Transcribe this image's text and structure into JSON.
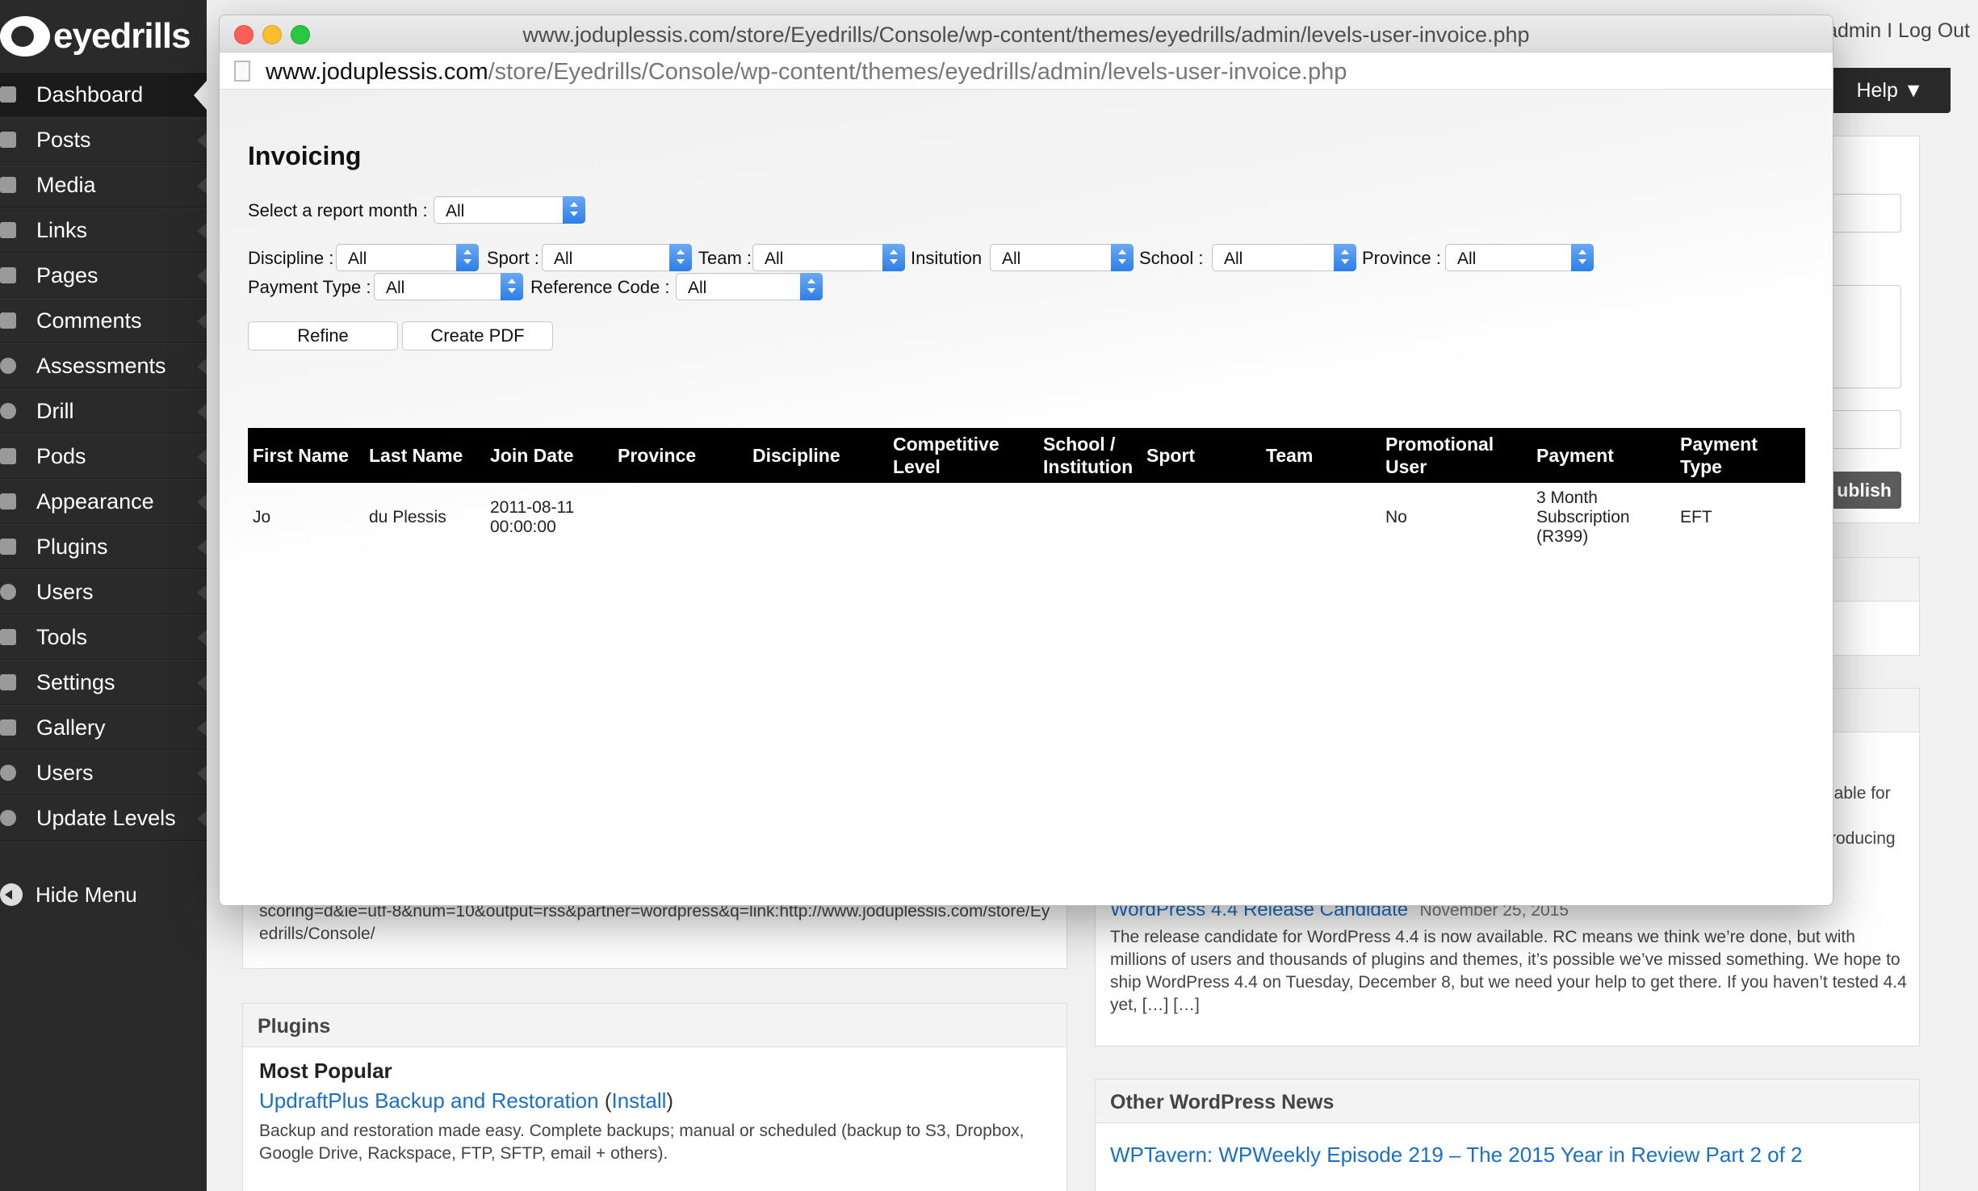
{
  "brand": {
    "logo_text": "eyedrills"
  },
  "sidebar": {
    "items": [
      {
        "label": "Dashboard",
        "icon": "home-icon",
        "active": true
      },
      {
        "label": "Posts",
        "icon": "pin-icon"
      },
      {
        "label": "Media",
        "icon": "media-icon"
      },
      {
        "label": "Links",
        "icon": "link-icon"
      },
      {
        "label": "Pages",
        "icon": "pages-icon"
      },
      {
        "label": "Comments",
        "icon": "comment-icon"
      },
      {
        "label": "Assessments",
        "icon": "gear-icon"
      },
      {
        "label": "Drill",
        "icon": "gear-icon"
      },
      {
        "label": "Pods",
        "icon": "pods-icon"
      },
      {
        "label": "Appearance",
        "icon": "appearance-icon"
      },
      {
        "label": "Plugins",
        "icon": "plugin-icon"
      },
      {
        "label": "Users",
        "icon": "users-icon"
      },
      {
        "label": "Tools",
        "icon": "tools-icon"
      },
      {
        "label": "Settings",
        "icon": "settings-icon"
      },
      {
        "label": "Gallery",
        "icon": "gallery-icon"
      },
      {
        "label": "Users",
        "icon": "plugin-icon"
      },
      {
        "label": "Update Levels",
        "icon": "plugin-icon"
      }
    ],
    "hide_menu": "Hide Menu"
  },
  "topbar": {
    "user_links": "admin I Log Out",
    "help": "Help ▼"
  },
  "background": {
    "publish": "ublish",
    "feed_text": "scoring=d&ie=utf-8&num=10&output=rss&partner=wordpress&q=link:http://www.joduplessis.com/store/Eyedrills/Console/",
    "right_fragment_1": "lable for",
    "right_fragment_2": "roducing",
    "release_title": "WordPress 4.4 Release Candidate",
    "release_date": "November 25, 2015",
    "release_text": "The release candidate for WordPress 4.4 is now available. RC means we think we’re done, but with millions of users and thousands of plugins and themes, it’s possible we’ve missed something. We hope to ship WordPress 4.4 on Tuesday, December 8, but we need your help to get there. If you haven’t tested 4.4 yet, […] […]",
    "plugins_title": "Plugins",
    "most_popular": "Most Popular",
    "plugin_name": "UpdraftPlus Backup and Restoration",
    "plugin_install": "Install",
    "plugin_desc": "Backup and restoration made easy. Complete backups; manual or scheduled (backup to S3, Dropbox, Google Drive, Rackspace, FTP, SFTP, email + others).",
    "other_news_title": "Other WordPress News",
    "other_news_link": "WPTavern: WPWeekly Episode 219 – The 2015 Year in Review Part 2 of 2"
  },
  "popup": {
    "window_title": "www.joduplessis.com/store/Eyedrills/Console/wp-content/themes/eyedrills/admin/levels-user-invoice.php",
    "url_host": "www.joduplessis.com",
    "url_path": "/store/Eyedrills/Console/wp-content/themes/eyedrills/admin/levels-user-invoice.php",
    "heading": "Invoicing",
    "report_month_label": "Select a report month :",
    "report_month_value": "All",
    "filters": {
      "discipline": {
        "label": "Discipline :",
        "value": "All"
      },
      "sport": {
        "label": "Sport :",
        "value": "All"
      },
      "team": {
        "label": "Team :",
        "value": "All"
      },
      "institution": {
        "label": "Insitution",
        "value": "All"
      },
      "school": {
        "label": "School :",
        "value": "All"
      },
      "province": {
        "label": "Province :",
        "value": "All"
      },
      "payment_type": {
        "label": "Payment Type :",
        "value": "All"
      },
      "reference_code": {
        "label": "Reference Code :",
        "value": "All"
      }
    },
    "refine": "Refine",
    "create_pdf": "Create PDF",
    "table": {
      "headers": [
        "First Name",
        "Last Name",
        "Join Date",
        "Province",
        "Discipline",
        "Competitive Level",
        "School / Institution",
        "Sport",
        "Team",
        "Promotional User",
        "Payment",
        "Payment Type"
      ],
      "rows": [
        [
          "Jo",
          "du Plessis",
          "2011-08-11 00:00:00",
          "",
          "",
          "",
          "",
          "",
          "",
          "No",
          "3 Month Subscription (R399)",
          "EFT"
        ]
      ]
    }
  }
}
